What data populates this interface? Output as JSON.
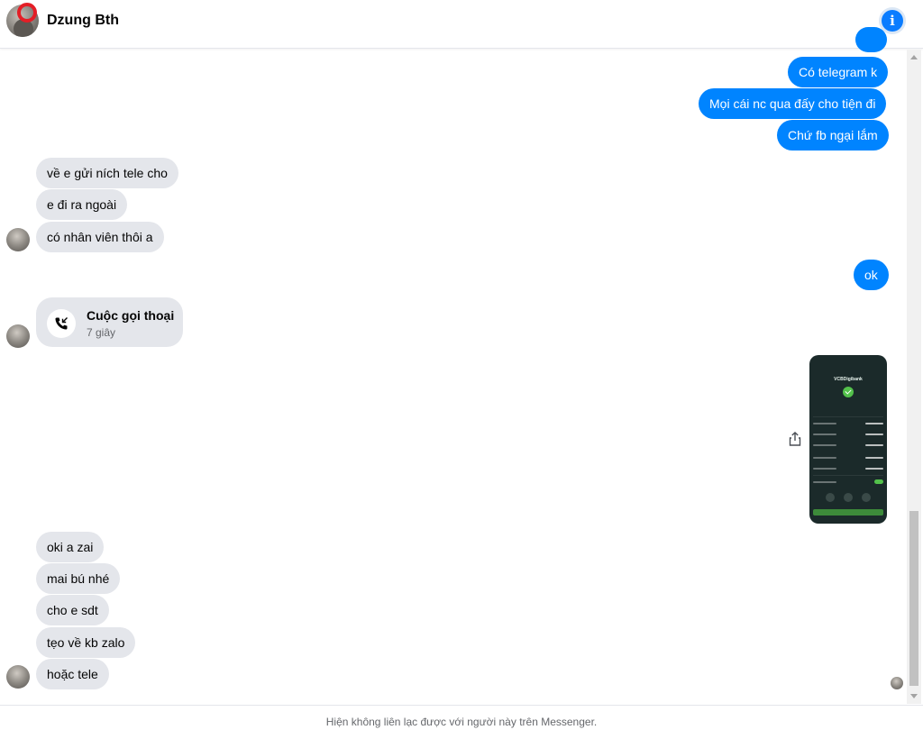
{
  "header": {
    "contact_name": "Dzung Bth",
    "info_icon": "info-icon",
    "accent_color": "#0084ff"
  },
  "messages": [
    {
      "side": "out",
      "text": ""
    },
    {
      "side": "out",
      "text": "Có telegram k"
    },
    {
      "side": "out",
      "text": "Mọi cái nc qua đấy cho tiện đi"
    },
    {
      "side": "out",
      "text": "Chứ fb ngại lắm"
    },
    {
      "side": "in",
      "text": "về e gửi ních tele cho"
    },
    {
      "side": "in",
      "text": "e đi ra ngoài"
    },
    {
      "side": "in",
      "text": "có nhân viên thôi a"
    },
    {
      "side": "out",
      "text": "ok"
    },
    {
      "side": "in",
      "type": "call",
      "title": "Cuộc gọi thoại",
      "subtitle": "7 giây"
    },
    {
      "side": "out",
      "type": "image",
      "brand": "VCBDigibank"
    },
    {
      "side": "in",
      "text": "oki a zai"
    },
    {
      "side": "in",
      "text": "mai bú nhé"
    },
    {
      "side": "in",
      "text": "cho e sdt"
    },
    {
      "side": "in",
      "text": "tẹo về kb zalo"
    },
    {
      "side": "in",
      "text": "hoặc tele"
    }
  ],
  "footer": {
    "notice": "Hiện không liên lạc được với người này trên Messenger."
  }
}
